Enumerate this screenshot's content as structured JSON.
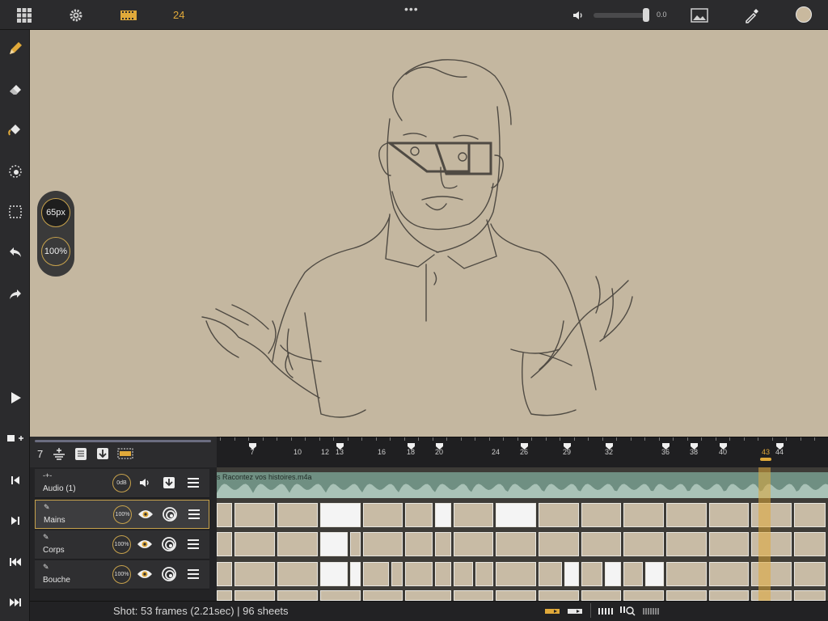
{
  "topbar": {
    "fps": "24",
    "volume_value": "0.0"
  },
  "brush": {
    "size": "65px",
    "opacity": "100%"
  },
  "timeline": {
    "current_frame_count": "7",
    "ruler_labels": [
      "7",
      "10",
      "12",
      "13",
      "16",
      "18",
      "20",
      "24",
      "26",
      "29",
      "32",
      "36",
      "38",
      "40",
      "43",
      "44"
    ],
    "current_frame": "43",
    "audio_clip_name": "s Racontez vos histoires.m4a"
  },
  "layers": [
    {
      "name": "Audio (1)",
      "level": "0dB"
    },
    {
      "name": "Mains",
      "opacity": "100%",
      "selected": true
    },
    {
      "name": "Corps",
      "opacity": "100%"
    },
    {
      "name": "Bouche",
      "opacity": "100%"
    }
  ],
  "status": {
    "text": "Shot: 53 frames (2.21sec) | 96 sheets"
  },
  "colors": {
    "accent": "#e0a93a",
    "canvas": "#c4b7a0",
    "audio_track": "#6f8f82",
    "current_color": "#c9b99e"
  },
  "icons": {
    "top": [
      "grid-icon",
      "gear-icon",
      "film-strip-icon",
      "more-icon",
      "speaker-icon",
      "image-icon",
      "eyedropper-icon",
      "color-swatch"
    ],
    "left": [
      "pencil-icon",
      "eraser-icon",
      "fill-bucket-icon",
      "lasso-icon",
      "selection-icon",
      "undo-icon",
      "redo-icon",
      "play-icon",
      "add-frame-icon",
      "go-start-icon",
      "go-end-icon",
      "go-first-icon",
      "go-last-icon"
    ]
  }
}
